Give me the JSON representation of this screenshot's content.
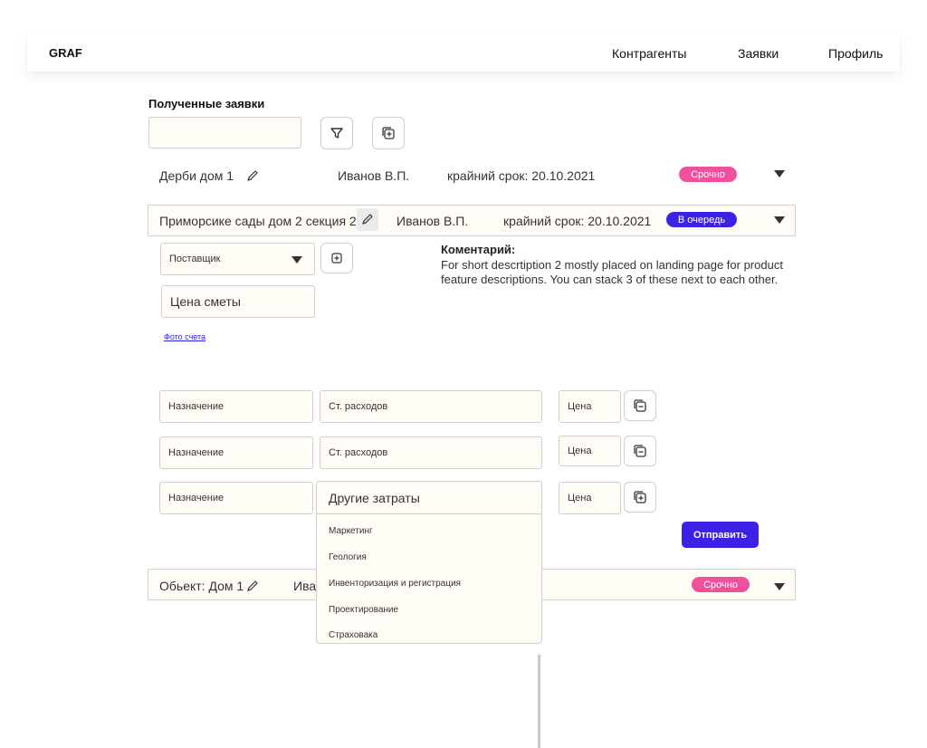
{
  "navbar": {
    "brand": "GRAF",
    "items": [
      "Контрагенты",
      "Заявки",
      "Профиль"
    ]
  },
  "page_title": "Полученные заявки",
  "search": {
    "value": ""
  },
  "requests": [
    {
      "title": "Дерби дом 1",
      "person": "Иванов В.П.",
      "deadline": "крайний срок: 20.10.2021",
      "badge": "Срочно",
      "badge_color": "#f0509c"
    },
    {
      "title": "Приморсике сады дом 2 секция 2",
      "person": "Иванов В.П.",
      "deadline": "крайний срок: 20.10.2021",
      "badge": "В очередь",
      "badge_color": "#3b22e6"
    },
    {
      "title": "Обьект: Дом 1",
      "person": "Ива",
      "deadline": "",
      "badge": "Срочно",
      "badge_color": "#f0509c"
    }
  ],
  "details": {
    "supplier_select": "Поставщик",
    "estimate_price": "Цена сметы",
    "photo_link": "Фото счета",
    "comment_title": "Коментарий:",
    "comment_text": "For short descrtiption 2 mostly placed on landing page for product feature descriptions. You can stack 3 of these next to each other."
  },
  "expense_rows": [
    {
      "purpose": "Назначение",
      "category": "Ст. расходов",
      "price": "Цена",
      "action": "remove"
    },
    {
      "purpose": "Назначение",
      "category": "Ст. расходов",
      "price": "Цена",
      "action": "remove"
    },
    {
      "purpose": "Назначение",
      "category": "Другие затраты",
      "price": "Цена",
      "action": "add"
    }
  ],
  "category_options": [
    "Маркетинг",
    "Геология",
    "Инвенторизация и регистрация",
    "Проектирование",
    "Страховака"
  ],
  "submit_label": "Отправить",
  "colors": {
    "accent": "#3b22e6",
    "urgent": "#f0509c",
    "field_bg": "#fffdf6"
  },
  "icons": [
    "filter-icon",
    "copy-add-icon",
    "pencil-icon",
    "caret-down-icon",
    "copy-remove-icon"
  ]
}
